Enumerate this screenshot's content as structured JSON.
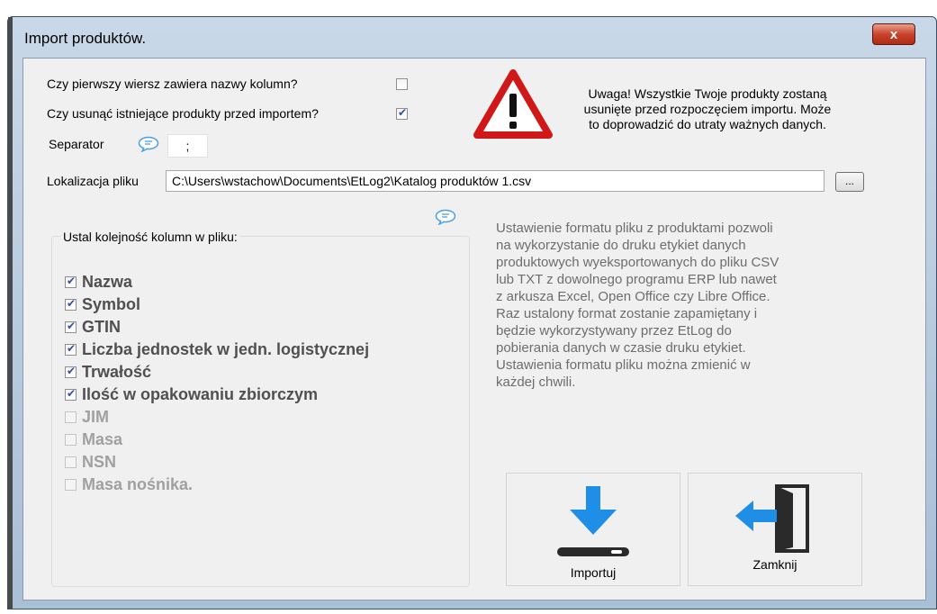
{
  "window": {
    "title": "Import produktów.",
    "close_label": "x"
  },
  "options": {
    "header_row_label": "Czy pierwszy wiersz zawiera nazwy kolumn?",
    "header_row_checked": false,
    "delete_existing_label": "Czy usunąć istniejące produkty przed importem?",
    "delete_existing_checked": true,
    "separator_label": "Separator",
    "separator_value": ";",
    "file_location_label": "Lokalizacja pliku",
    "file_path": "C:\\Users\\wstachow\\Documents\\EtLog2\\Katalog produktów 1.csv",
    "browse_label": "..."
  },
  "warning": {
    "icon": "warning-triangle-icon",
    "lines": [
      "Uwaga! Wszystkie Twoje produkty zostaną",
      "usunięte przed rozpoczęciem importu. Może",
      "to doprowadzić do utraty ważnych danych."
    ]
  },
  "columns_group": {
    "title": "Ustal kolejność kolumn w pliku:",
    "items": [
      {
        "label": "Nazwa",
        "checked": true,
        "enabled": true
      },
      {
        "label": "Symbol",
        "checked": true,
        "enabled": true
      },
      {
        "label": "GTIN",
        "checked": true,
        "enabled": true
      },
      {
        "label": "Liczba jednostek w jedn. logistycznej",
        "checked": true,
        "enabled": true
      },
      {
        "label": "Trwałość",
        "checked": true,
        "enabled": true
      },
      {
        "label": "Ilość w opakowaniu zbiorczym",
        "checked": true,
        "enabled": true
      },
      {
        "label": "JIM",
        "checked": false,
        "enabled": false
      },
      {
        "label": "Masa",
        "checked": false,
        "enabled": false
      },
      {
        "label": "NSN",
        "checked": false,
        "enabled": false
      },
      {
        "label": "Masa nośnika.",
        "checked": false,
        "enabled": false
      }
    ]
  },
  "info": {
    "lines": [
      "Ustawienie formatu pliku z produktami pozwoli",
      "na wykorzystanie do druku etykiet danych",
      "produktowych wyeksportowanych do pliku CSV",
      "lub TXT z dowolnego programu ERP lub nawet",
      "z arkusza Excel, Open Office czy Libre Office.",
      "Raz ustalony format zostanie zapamiętany i",
      "będzie wykorzystywany przez EtLog do",
      "pobierania danych w czasie druku etykiet.",
      "Ustawienia formatu pliku można zmienić w",
      "każdej chwili."
    ]
  },
  "buttons": {
    "import_label": "Importuj",
    "import_icon": "download-arrow-icon",
    "close_label": "Zamknij",
    "close_icon": "exit-door-icon"
  },
  "colors": {
    "accent_blue": "#1e8ee6",
    "warning_red": "#d01818",
    "close_red": "#c8442c"
  }
}
